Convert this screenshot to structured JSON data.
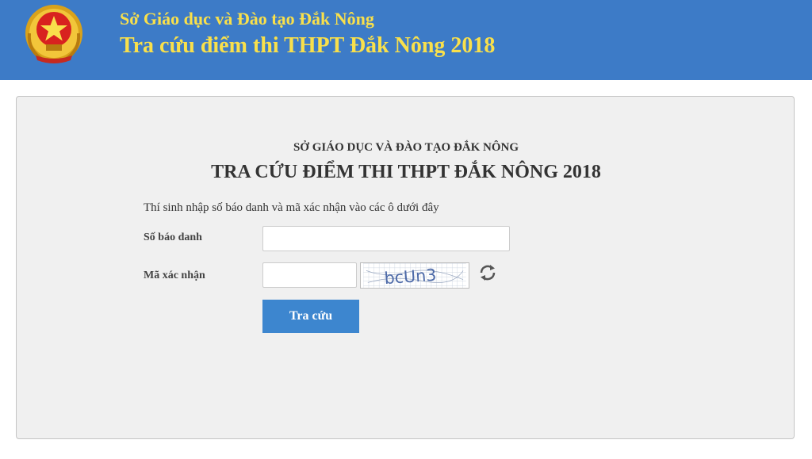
{
  "header": {
    "line1": "Sở Giáo dục và Đào tạo Đắk Nông",
    "line2": "Tra cứu điểm thi THPT Đắk Nông 2018",
    "emblem_icon": "national-emblem-icon"
  },
  "panel": {
    "subtitle": "SỞ GIÁO DỤC VÀ ĐÀO TẠO ĐẮK NÔNG",
    "title": "TRA CỨU ĐIỂM THI THPT ĐẮK NÔNG 2018",
    "instruction": "Thí sinh nhập số báo danh và mã xác nhận vào các ô dưới đây",
    "sbd_label": "Số báo danh",
    "sbd_value": "",
    "captcha_label": "Mã xác nhận",
    "captcha_value": "",
    "captcha_text": "bcUn3",
    "refresh_icon": "refresh-icon",
    "submit_label": "Tra cứu"
  },
  "colors": {
    "header_bg": "#3d7bc7",
    "header_text": "#f9e04b",
    "panel_bg": "#f0f0f0",
    "button_bg": "#3d86cf"
  }
}
